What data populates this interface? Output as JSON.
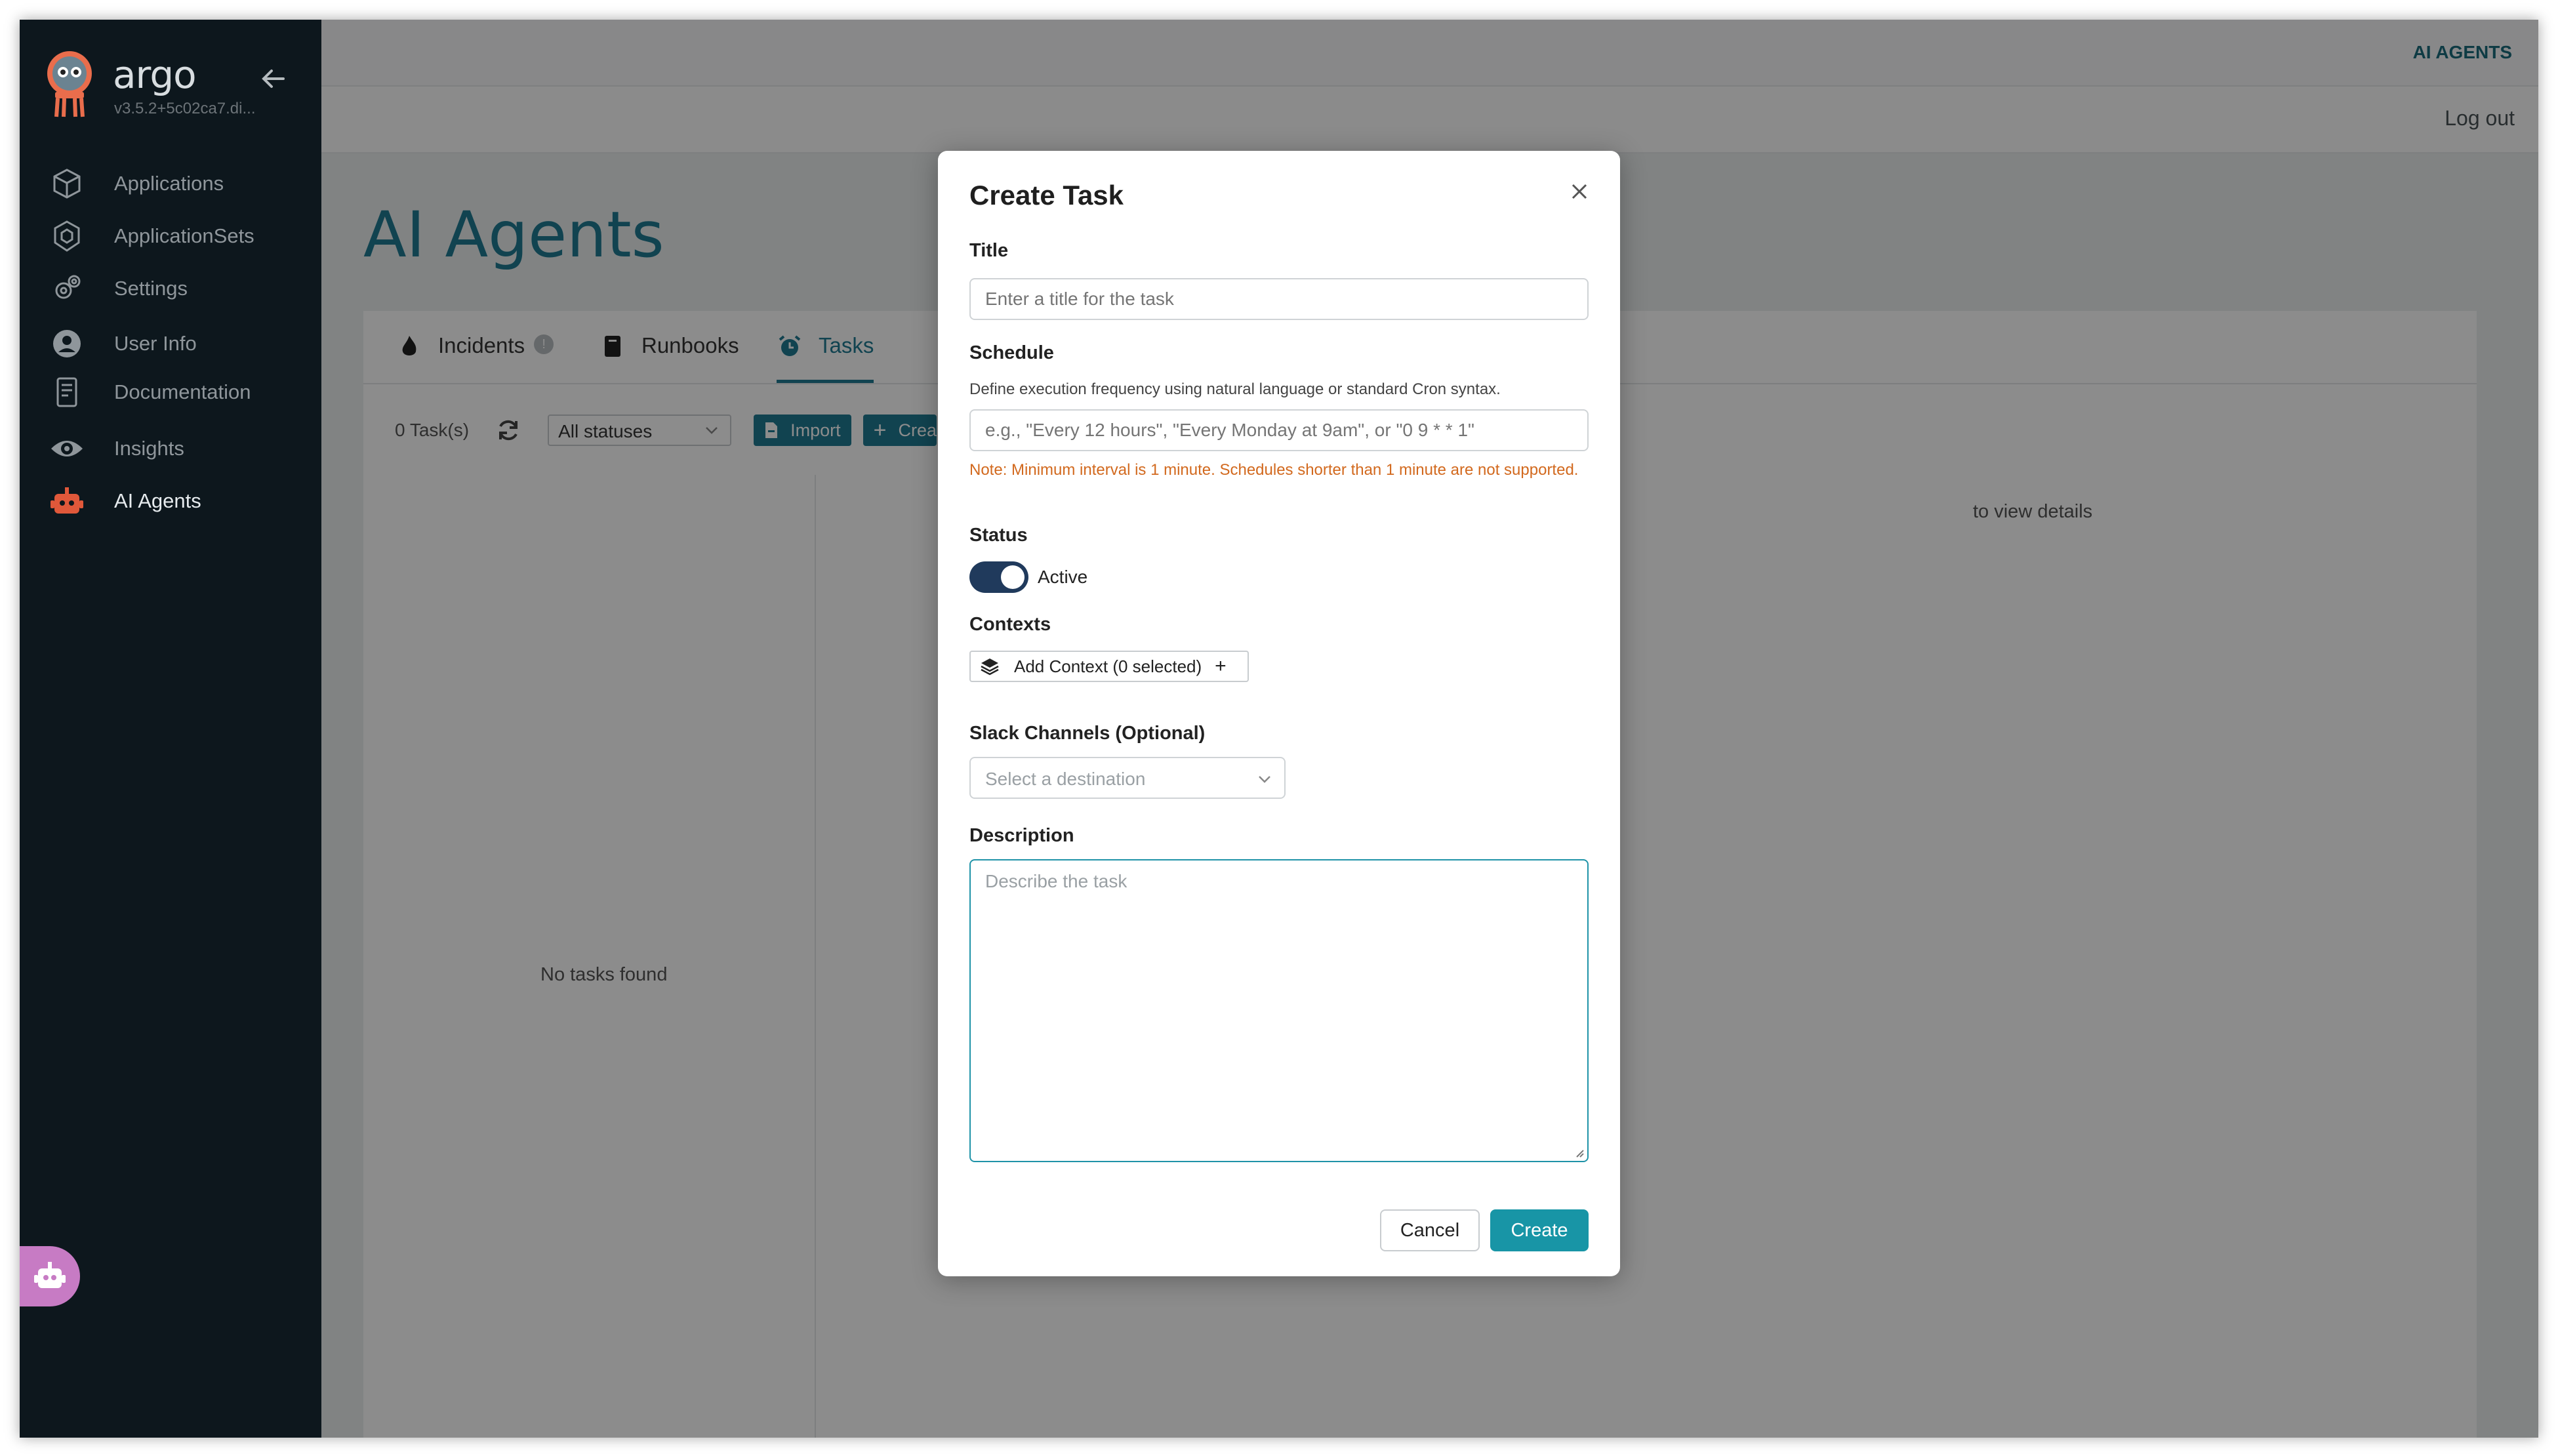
{
  "app": {
    "logo_text": "argo",
    "version": "v3.5.2+5c02ca7.di...",
    "header_crumb": "AI AGENTS",
    "logout_label": "Log out"
  },
  "sidebar": {
    "items": [
      {
        "label": "Applications",
        "icon": "cube-icon"
      },
      {
        "label": "ApplicationSets",
        "icon": "hexagons-icon"
      },
      {
        "label": "Settings",
        "icon": "gears-icon"
      },
      {
        "label": "User Info",
        "icon": "user-circle-icon"
      },
      {
        "label": "Documentation",
        "icon": "book-icon"
      },
      {
        "label": "Insights",
        "icon": "eye-icon"
      },
      {
        "label": "AI Agents",
        "icon": "robot-icon"
      }
    ]
  },
  "page": {
    "title": "AI Agents",
    "tabs": [
      {
        "label": "Incidents",
        "badge": "!"
      },
      {
        "label": "Runbooks"
      },
      {
        "label": "Tasks"
      }
    ],
    "task_count": "0 Task(s)",
    "status_filter": "All statuses",
    "import_label": "Import",
    "create_label": "Crea",
    "empty_text": "No tasks found",
    "detail_hint": "to view details"
  },
  "modal": {
    "title": "Create Task",
    "title_label": "Title",
    "title_placeholder": "Enter a title for the task",
    "schedule_label": "Schedule",
    "schedule_help": "Define execution frequency using natural language or standard Cron syntax.",
    "schedule_placeholder": "e.g., \"Every 12 hours\", \"Every Monday at 9am\", or \"0 9 * * 1\"",
    "schedule_note": "Note: Minimum interval is 1 minute. Schedules shorter than 1 minute are not supported.",
    "status_label": "Status",
    "status_value": "Active",
    "contexts_label": "Contexts",
    "add_context_label": "Add Context (0 selected)",
    "slack_label": "Slack Channels (Optional)",
    "slack_placeholder": "Select a destination",
    "description_label": "Description",
    "description_placeholder": "Describe the task",
    "cancel_label": "Cancel",
    "create_label": "Create"
  },
  "colors": {
    "accent": "#1f7b93",
    "primary_button": "#1895a6",
    "sidebar_bg": "#0d171d",
    "warning_text": "#d2691e",
    "toggle_on": "#203a5c"
  }
}
